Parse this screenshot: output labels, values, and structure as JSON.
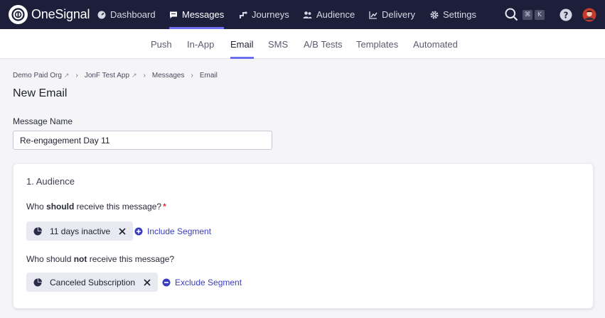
{
  "app": {
    "brand": "OneSignal",
    "colors": {
      "nav_bg": "#1d1f3a",
      "accent": "#6e6ff0",
      "link": "#3b3dbf",
      "required": "#e0303a"
    }
  },
  "topnav": {
    "items": [
      {
        "label": "Dashboard",
        "icon": "dashboard-icon"
      },
      {
        "label": "Messages",
        "icon": "chat-icon",
        "active": true
      },
      {
        "label": "Journeys",
        "icon": "journey-icon"
      },
      {
        "label": "Audience",
        "icon": "people-icon"
      },
      {
        "label": "Delivery",
        "icon": "chart-icon"
      },
      {
        "label": "Settings",
        "icon": "gear-icon"
      }
    ],
    "shortcut": {
      "key1": "⌘",
      "key2": "K"
    }
  },
  "subnav": {
    "items": [
      {
        "label": "Push"
      },
      {
        "label": "In-App"
      },
      {
        "label": "Email",
        "active": true
      },
      {
        "label": "SMS"
      },
      {
        "label": "A/B Tests"
      },
      {
        "label": "Templates"
      },
      {
        "label": "Automated"
      }
    ]
  },
  "breadcrumb": {
    "items": [
      "Demo Paid Org",
      "JonF Test App",
      "Messages",
      "Email"
    ]
  },
  "page": {
    "title": "New Email",
    "message_name_label": "Message Name",
    "message_name_value": "Re-engagement Day 11"
  },
  "audience": {
    "title": "1. Audience",
    "include_q_pre": "Who ",
    "include_q_bold": "should",
    "include_q_post": " receive this message?",
    "required_mark": "*",
    "include_segment": "11 days inactive",
    "include_button": "Include Segment",
    "exclude_q_pre": "Who should ",
    "exclude_q_bold": "not",
    "exclude_q_post": " receive this message?",
    "exclude_segment": "Canceled Subscription",
    "exclude_button": "Exclude Segment"
  }
}
